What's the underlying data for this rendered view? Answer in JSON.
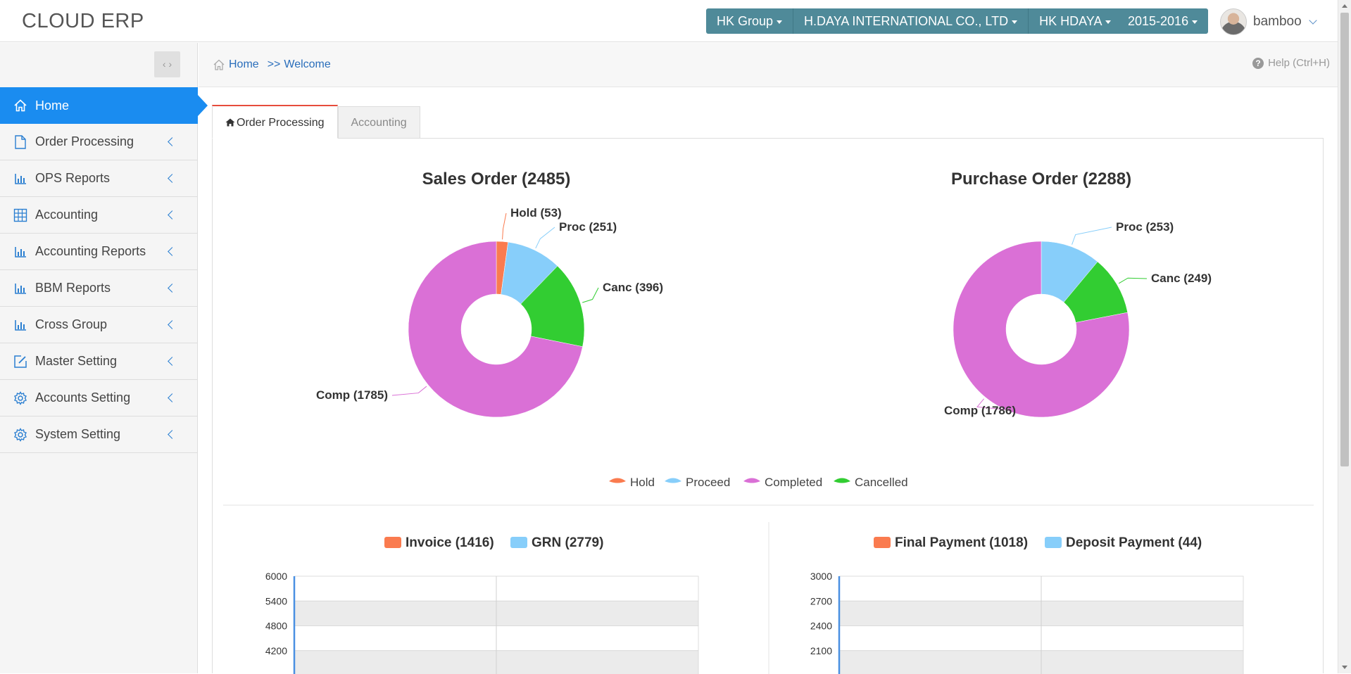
{
  "app": {
    "title": "CLOUD ERP"
  },
  "topbar": {
    "group": "HK Group",
    "company": "H.DAYA INTERNATIONAL CO., LTD",
    "branch": "HK HDAYA",
    "year": "2015-2016",
    "user": "bamboo"
  },
  "sidebar": {
    "items": [
      {
        "label": "Home",
        "icon": "home-icon"
      },
      {
        "label": "Order Processing",
        "icon": "document-icon"
      },
      {
        "label": "OPS Reports",
        "icon": "bar-chart-icon"
      },
      {
        "label": "Accounting",
        "icon": "grid-table-icon"
      },
      {
        "label": "Accounting Reports",
        "icon": "bar-chart-icon"
      },
      {
        "label": "BBM Reports",
        "icon": "bar-chart-icon"
      },
      {
        "label": "Cross Group",
        "icon": "bar-chart-icon"
      },
      {
        "label": "Master Setting",
        "icon": "edit-icon"
      },
      {
        "label": "Accounts Setting",
        "icon": "gear-icon"
      },
      {
        "label": "System Setting",
        "icon": "gear-icon"
      }
    ]
  },
  "breadcrumb": {
    "home": "Home",
    "sep": ">>",
    "current": "Welcome"
  },
  "help": {
    "label": "Help (Ctrl+H)"
  },
  "tabs": [
    {
      "label": "Order Processing",
      "active": true
    },
    {
      "label": "Accounting",
      "active": false
    }
  ],
  "colors": {
    "hold": "#fa7b4f",
    "proceed": "#87cefa",
    "completed": "#da70d6",
    "cancelled": "#32cd32",
    "accent": "#1a8cf0",
    "toolbar": "#4f8a99"
  },
  "chart_data": [
    {
      "type": "pie",
      "title": "Sales Order (2485)",
      "slices": [
        {
          "key": "Hold",
          "label": "Hold (53)",
          "value": 53,
          "color": "#fa7b4f"
        },
        {
          "key": "Proc",
          "label": "Proc (251)",
          "value": 251,
          "color": "#87cefa"
        },
        {
          "key": "Canc",
          "label": "Canc (396)",
          "value": 396,
          "color": "#32cd32"
        },
        {
          "key": "Comp",
          "label": "Comp (1785)",
          "value": 1785,
          "color": "#da70d6"
        }
      ]
    },
    {
      "type": "pie",
      "title": "Purchase Order (2288)",
      "slices": [
        {
          "key": "Hold",
          "label": "",
          "value": 0,
          "color": "#fa7b4f"
        },
        {
          "key": "Proc",
          "label": "Proc (253)",
          "value": 253,
          "color": "#87cefa"
        },
        {
          "key": "Canc",
          "label": "Canc (249)",
          "value": 249,
          "color": "#32cd32"
        },
        {
          "key": "Comp",
          "label": "Comp (1786)",
          "value": 1786,
          "color": "#da70d6"
        }
      ]
    },
    {
      "type": "bar",
      "legend": [
        {
          "label": "Invoice (1416)",
          "color": "#fa7b4f"
        },
        {
          "label": "GRN (2779)",
          "color": "#87cefa"
        }
      ],
      "yticks": [
        "6000",
        "5400",
        "4800",
        "4200"
      ],
      "ylim_visible": [
        3600,
        6000
      ]
    },
    {
      "type": "bar",
      "legend": [
        {
          "label": "Final Payment (1018)",
          "color": "#fa7b4f"
        },
        {
          "label": "Deposit Payment (44)",
          "color": "#87cefa"
        }
      ],
      "yticks": [
        "3000",
        "2700",
        "2400",
        "2100"
      ],
      "ylim_visible": [
        1800,
        3000
      ]
    }
  ],
  "pie_legend": [
    {
      "label": "Hold",
      "color": "#fa7b4f"
    },
    {
      "label": "Proceed",
      "color": "#87cefa"
    },
    {
      "label": "Completed",
      "color": "#da70d6"
    },
    {
      "label": "Cancelled",
      "color": "#32cd32"
    }
  ]
}
